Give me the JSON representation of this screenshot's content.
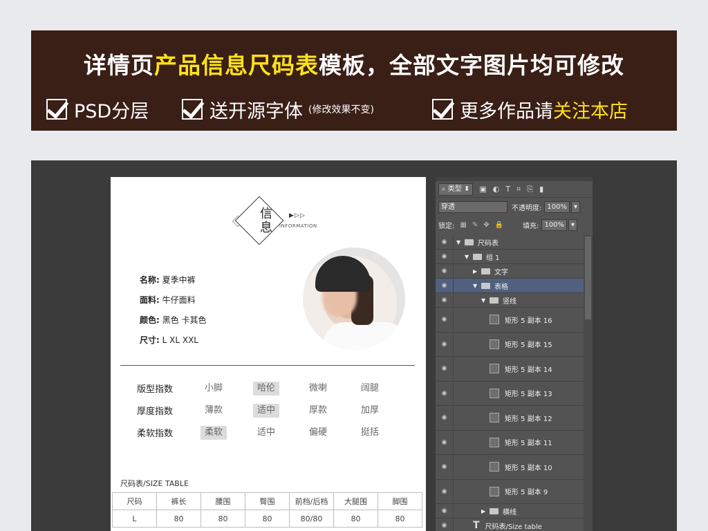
{
  "banner": {
    "title_pre": "详情页",
    "title_hl": "产品信息尺码表",
    "title_post": "模板，全部文字图片均可修改",
    "features": [
      {
        "text": "PSD分层"
      },
      {
        "text": "送开源字体",
        "note": "(修改效果不变)"
      },
      {
        "text": "更多作品请",
        "hl": "关注本店"
      }
    ]
  },
  "doc": {
    "logo": {
      "char1": "信",
      "char2": "息",
      "arrows": "▶▷▷",
      "en": "INFORMATION"
    },
    "info": [
      {
        "key": "名称:",
        "value": "夏季中裤"
      },
      {
        "key": "面料:",
        "value": "牛仔面料"
      },
      {
        "key": "颜色:",
        "value": "黑色 卡其色"
      },
      {
        "key": "尺寸:",
        "value": "L XL XXL"
      }
    ],
    "indices": [
      {
        "label": "版型指数",
        "options": [
          "小脚",
          "哈伦",
          "微喇",
          "阔腿"
        ],
        "selected": 1
      },
      {
        "label": "厚度指数",
        "options": [
          "薄款",
          "适中",
          "厚款",
          "加厚"
        ],
        "selected": 1
      },
      {
        "label": "柔软指数",
        "options": [
          "柔软",
          "适中",
          "偏硬",
          "挺括"
        ],
        "selected": 0
      }
    ],
    "size_table": {
      "title": "尺码表/SIZE TABLE",
      "headers": [
        "尺码",
        "裤长",
        "腰围",
        "臀围",
        "前档/后档",
        "大腿围",
        "脚围"
      ],
      "rows": [
        [
          "L",
          "80",
          "80",
          "80",
          "80/80",
          "80",
          "80"
        ]
      ]
    }
  },
  "panel": {
    "filter_label": "类型",
    "blend_mode": "穿透",
    "opacity_label": "不透明度:",
    "opacity_value": "100%",
    "lock_label": "锁定:",
    "fill_label": "填充:",
    "fill_value": "100%",
    "layers": [
      {
        "name": "尺码表",
        "type": "folder",
        "indent": 0,
        "expanded": true
      },
      {
        "name": "组 1",
        "type": "folder",
        "indent": 1,
        "expanded": true
      },
      {
        "name": "文字",
        "type": "folder",
        "indent": 2,
        "expanded": false
      },
      {
        "name": "表格",
        "type": "folder",
        "indent": 2,
        "expanded": true,
        "selected": true
      },
      {
        "name": "竖线",
        "type": "folder",
        "indent": 3,
        "expanded": true
      },
      {
        "name": "矩形 5 副本 16",
        "type": "shape",
        "indent": 4
      },
      {
        "name": "矩形 5 副本 15",
        "type": "shape",
        "indent": 4
      },
      {
        "name": "矩形 5 副本 14",
        "type": "shape",
        "indent": 4
      },
      {
        "name": "矩形 5 副本 13",
        "type": "shape",
        "indent": 4
      },
      {
        "name": "矩形 5 副本 12",
        "type": "shape",
        "indent": 4
      },
      {
        "name": "矩形 5 副本 11",
        "type": "shape",
        "indent": 4
      },
      {
        "name": "矩形 5 副本 10",
        "type": "shape",
        "indent": 4
      },
      {
        "name": "矩形 5 副本 9",
        "type": "shape",
        "indent": 4
      },
      {
        "name": "横线",
        "type": "folder",
        "indent": 3,
        "expanded": false
      },
      {
        "name": "尺码表/Size table",
        "type": "text",
        "indent": 2
      }
    ]
  },
  "colors": {
    "banner_bg": "#3a1f17",
    "highlight": "#ffe21a",
    "editor_bg": "#3b3b3b",
    "panel_bg": "#535353",
    "selected_layer": "#50607e"
  }
}
